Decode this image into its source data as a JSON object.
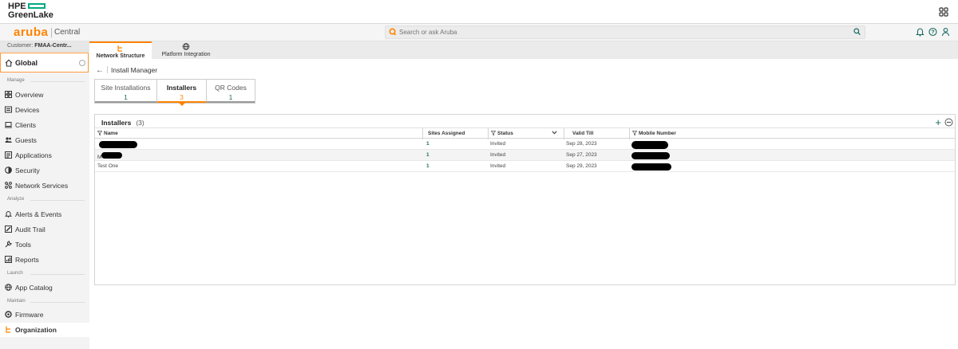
{
  "hpe": {
    "logo_line1": "HPE",
    "logo_line2": "GreenLake",
    "brand_color": "#01a982"
  },
  "aruba": {
    "logo": "aruba",
    "product": "Central",
    "brand_color": "#ff8300",
    "search_placeholder": "Search or ask Aruba"
  },
  "customer": {
    "label": "Customer:",
    "name": "FMAA-Centr..."
  },
  "top_tabs": [
    {
      "label": "Network Structure",
      "icon": "network-structure-icon",
      "active": true
    },
    {
      "label": "Platform Integration",
      "icon": "globe-icon",
      "active": false
    }
  ],
  "sidebar": {
    "global_label": "Global",
    "sections": {
      "manage": "Manage",
      "analyze": "Analyze",
      "launch": "Launch",
      "maintain": "Maintain"
    },
    "items": [
      {
        "label": "Overview",
        "icon": "overview-icon"
      },
      {
        "label": "Devices",
        "icon": "devices-icon"
      },
      {
        "label": "Clients",
        "icon": "clients-icon"
      },
      {
        "label": "Guests",
        "icon": "guests-icon"
      },
      {
        "label": "Applications",
        "icon": "applications-icon"
      },
      {
        "label": "Security",
        "icon": "security-icon"
      },
      {
        "label": "Network Services",
        "icon": "network-services-icon"
      },
      {
        "label": "Alerts & Events",
        "icon": "bell-icon"
      },
      {
        "label": "Audit Trail",
        "icon": "audit-trail-icon"
      },
      {
        "label": "Tools",
        "icon": "tools-icon"
      },
      {
        "label": "Reports",
        "icon": "reports-icon"
      },
      {
        "label": "App Catalog",
        "icon": "globe-icon"
      },
      {
        "label": "Firmware",
        "icon": "firmware-icon"
      },
      {
        "label": "Organization",
        "icon": "organization-icon",
        "active": true
      }
    ]
  },
  "main": {
    "breadcrumb": "Install Manager",
    "sub_tabs": [
      {
        "label": "Site Installations",
        "count": "1",
        "active": false
      },
      {
        "label": "Installers",
        "count": "3",
        "active": true
      },
      {
        "label": "QR Codes",
        "count": "1",
        "active": false
      }
    ],
    "panel": {
      "title": "Installers",
      "count": "(3)",
      "columns": {
        "name": "Name",
        "sites": "Sites Assigned",
        "status": "Status",
        "valid_till": "Valid Till",
        "mobile": "Mobile Number"
      },
      "rows": [
        {
          "name": "",
          "sites": "1",
          "status": "Invited",
          "valid_till": "Sep 28, 2023",
          "mobile": ""
        },
        {
          "name": "M",
          "sites": "1",
          "status": "Invited",
          "valid_till": "Sep 27, 2023",
          "mobile": ""
        },
        {
          "name": "Test One",
          "sites": "1",
          "status": "Invited",
          "valid_till": "Sep 29, 2023",
          "mobile": ""
        }
      ]
    }
  }
}
